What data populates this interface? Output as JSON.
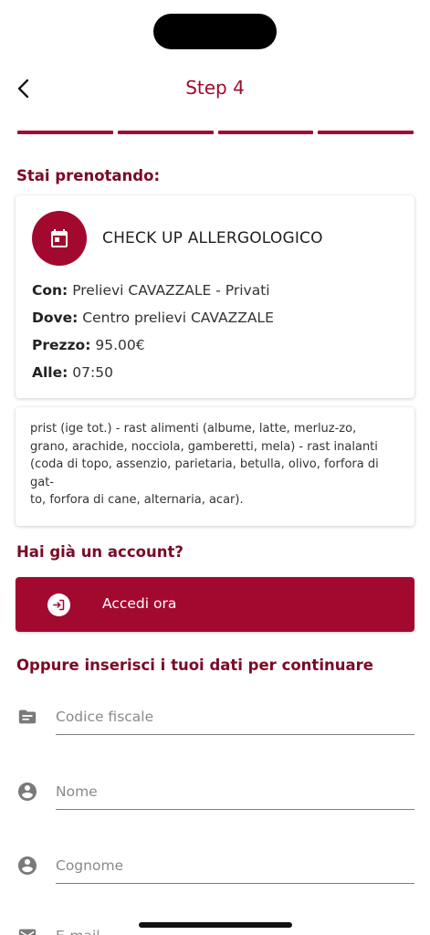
{
  "header": {
    "title": "Step 4"
  },
  "progress": {
    "total_steps": 4,
    "current_step": 4
  },
  "booking": {
    "section_title": "Stai prenotando:",
    "service_name": "CHECK UP ALLERGOLOGICO",
    "con_label": "Con:",
    "con_value": "Prelievi CAVAZZALE - Privati",
    "dove_label": "Dove:",
    "dove_value": "Centro prelievi CAVAZZALE",
    "prezzo_label": "Prezzo:",
    "prezzo_value": "95.00€",
    "alle_label": "Alle:",
    "alle_value": "07:50",
    "description_line1": "prist (ige tot.) - rast alimenti (albume, latte, merluz-zo,",
    "description_line2": "grano, arachide, nocciola, gamberetti, mela) - rast inalanti",
    "description_line3": "(coda di topo, assenzio, parietaria, betulla, olivo, forfora di",
    "description_line4": "gat-",
    "description_line5": "to, forfora di cane, alternaria, acar)."
  },
  "account": {
    "section_title": "Hai già un account?",
    "login_label": "Accedi ora"
  },
  "form": {
    "section_title": "Oppure inserisci i tuoi dati per continuare",
    "codice_fiscale_placeholder": "Codice fiscale",
    "nome_placeholder": "Nome",
    "cognome_placeholder": "Cognome",
    "email_placeholder": "E-mail"
  },
  "colors": {
    "primary": "#a3092f",
    "section_title": "#7a0a26"
  },
  "icons": {
    "back": "chevron-left-icon",
    "calendar": "calendar-icon",
    "login": "login-icon",
    "codice_fiscale": "folder-icon",
    "nome": "account-circle-icon",
    "cognome": "account-circle-icon",
    "email": "email-icon"
  }
}
